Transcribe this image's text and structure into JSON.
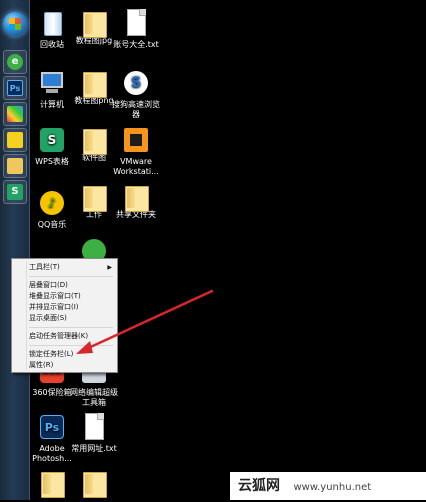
{
  "desktop": {
    "icons": [
      {
        "label": "回收站"
      },
      {
        "label": "教程图jpg"
      },
      {
        "label": "账号大全.txt"
      },
      {
        "label": "计算机"
      },
      {
        "label": "教程图png"
      },
      {
        "label": "搜狗高速浏览器"
      },
      {
        "label": "WPS表格"
      },
      {
        "label": "软件图"
      },
      {
        "label": "VMware Workstati..."
      },
      {
        "label": "QQ音乐"
      },
      {
        "label": "工作"
      },
      {
        "label": "共享文件夹"
      },
      {
        "label": "360保险箱"
      },
      {
        "label": "网络编辑超级工具箱"
      },
      {
        "label": "Adobe Photosh..."
      },
      {
        "label": "常用网址.txt"
      }
    ]
  },
  "context_menu": {
    "items": [
      {
        "label": "工具栏(T)",
        "has_submenu": true
      },
      {
        "label": "层叠窗口(D)"
      },
      {
        "label": "堆叠显示窗口(T)"
      },
      {
        "label": "并排显示窗口(I)"
      },
      {
        "label": "显示桌面(S)"
      },
      {
        "label": "启动任务管理器(K)"
      },
      {
        "label": "锁定任务栏(L)"
      },
      {
        "label": "属性(R)"
      }
    ]
  },
  "watermark": {
    "logo": "云狐网",
    "url": "www.yunhu.net"
  },
  "colors": {
    "arrow": "#d8262a",
    "menu_bg": "#f2f2f2"
  }
}
